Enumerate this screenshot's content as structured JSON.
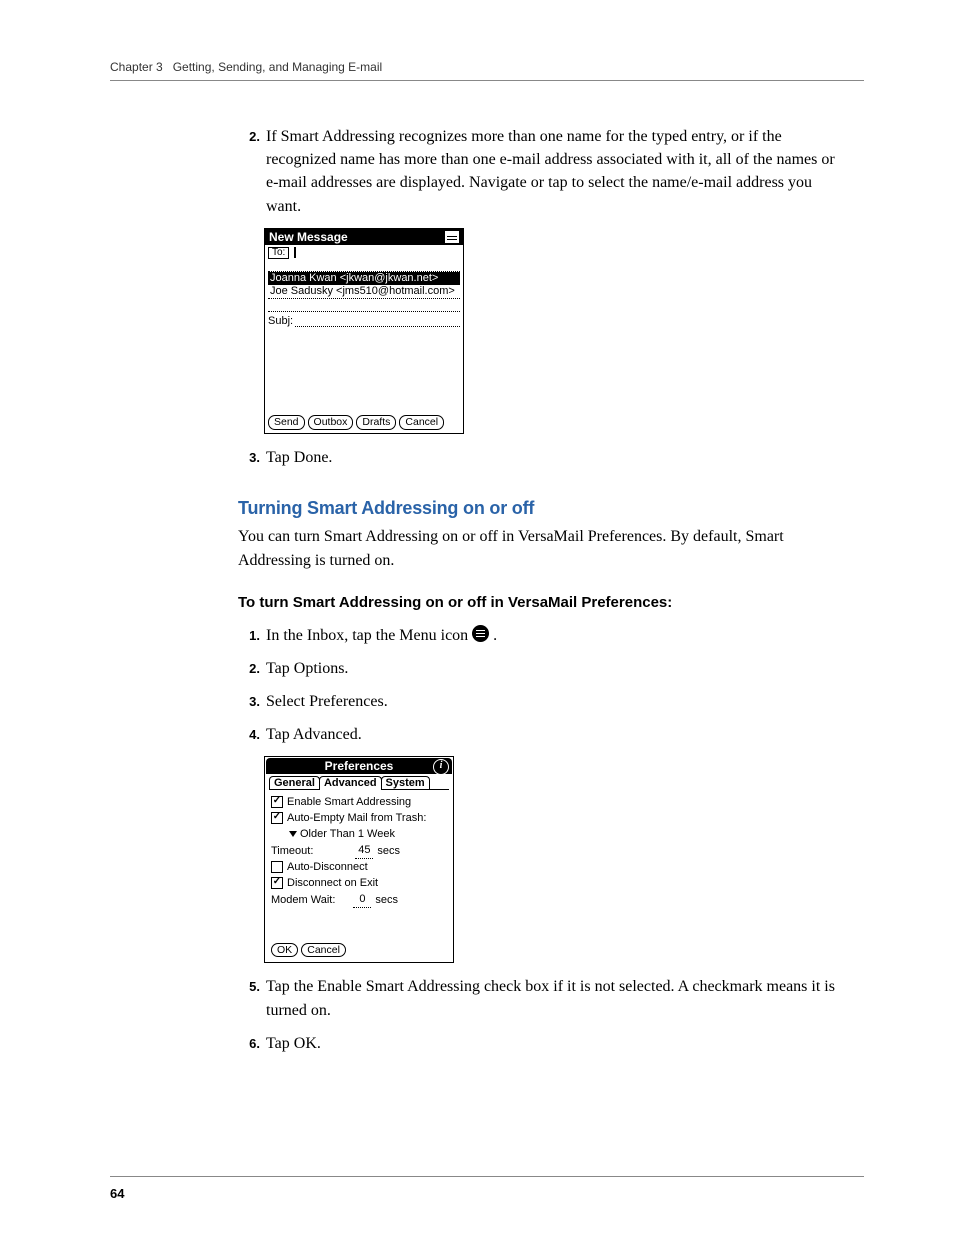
{
  "header": {
    "chapter_label": "Chapter 3",
    "chapter_title": "Getting, Sending, and Managing E-mail"
  },
  "page_number": "64",
  "sections": {
    "step2_text": "If Smart Addressing recognizes more than one name for the typed entry, or if the recognized name has more than one e-mail address associated with it, all of the names or e-mail addresses are displayed. Navigate or tap to select the name/e-mail address you want.",
    "step3_text": "Tap Done.",
    "h_blue": "Turning Smart Addressing on or off",
    "blue_para": "You can turn Smart Addressing on or off in VersaMail Preferences. By default, Smart Addressing is turned on.",
    "h_task": "To turn Smart Addressing on or off in VersaMail Preferences:",
    "proc": {
      "s1a": "In the Inbox, tap the Menu icon ",
      "s1b": " .",
      "s2": "Tap Options.",
      "s3": "Select Preferences.",
      "s4": "Tap Advanced.",
      "s5": "Tap the Enable Smart Addressing check box if it is not selected. A checkmark means it is turned on.",
      "s6": "Tap OK."
    }
  },
  "palm1": {
    "title": "New Message",
    "to_label": "To:",
    "suggest1": "Joanna Kwan <jkwan@jkwan.net>",
    "suggest2": "Joe Sadusky <jms510@hotmail.com>",
    "subj_label": "Subj:",
    "buttons": {
      "send": "Send",
      "outbox": "Outbox",
      "drafts": "Drafts",
      "cancel": "Cancel"
    }
  },
  "palm2": {
    "title": "Preferences",
    "tabs": {
      "general": "General",
      "advanced": "Advanced",
      "system": "System"
    },
    "opts": {
      "enable_smart": "Enable Smart Addressing",
      "auto_empty": "Auto-Empty Mail from Trash:",
      "older": "Older Than 1 Week",
      "timeout_label": "Timeout:",
      "timeout_val": "45",
      "secs": "secs",
      "auto_disc": "Auto-Disconnect",
      "disc_exit": "Disconnect on Exit",
      "modem_label": "Modem Wait:",
      "modem_val": "0"
    },
    "buttons": {
      "ok": "OK",
      "cancel": "Cancel"
    }
  },
  "step_numbers": {
    "n1": "1.",
    "n2": "2.",
    "n3": "3.",
    "n4": "4.",
    "n5": "5.",
    "n6": "6."
  }
}
